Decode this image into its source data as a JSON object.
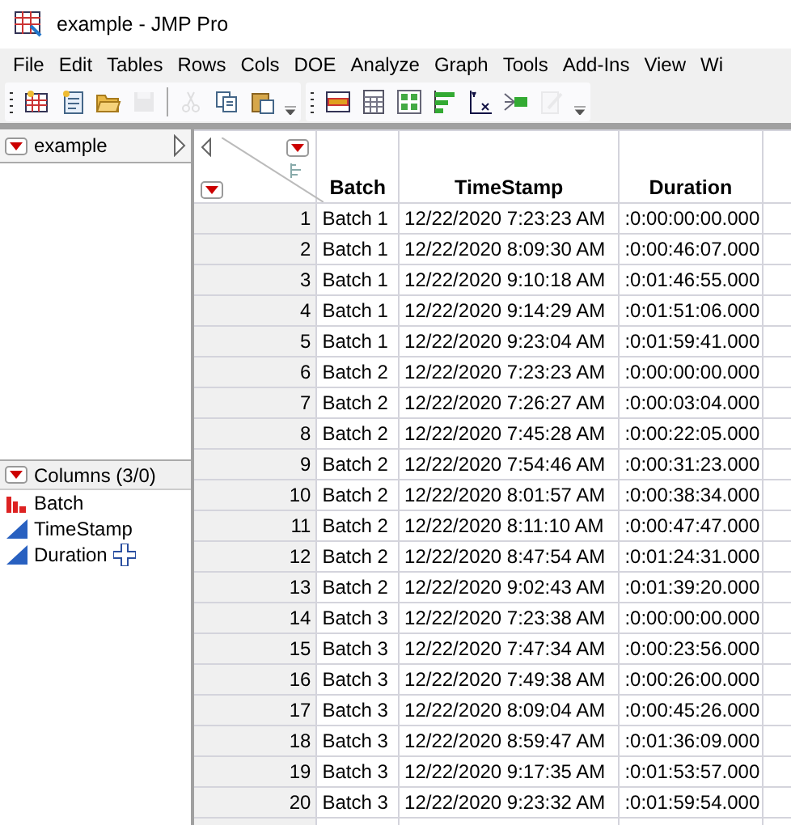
{
  "window": {
    "title": "example - JMP Pro"
  },
  "menu": [
    "File",
    "Edit",
    "Tables",
    "Rows",
    "Cols",
    "DOE",
    "Analyze",
    "Graph",
    "Tools",
    "Add-Ins",
    "View",
    "Wi"
  ],
  "toolbar_groups": [
    [
      {
        "kind": "new-table",
        "disabled": false
      },
      {
        "kind": "new-script",
        "disabled": false
      },
      {
        "kind": "open",
        "disabled": false
      },
      {
        "kind": "save",
        "disabled": true
      },
      {
        "kind": "sep"
      },
      {
        "kind": "cut",
        "disabled": true
      },
      {
        "kind": "copy",
        "disabled": false
      },
      {
        "kind": "paste",
        "disabled": false
      }
    ],
    [
      {
        "kind": "data-table",
        "disabled": false
      },
      {
        "kind": "tabulate",
        "disabled": false
      },
      {
        "kind": "grid",
        "disabled": false
      },
      {
        "kind": "bars",
        "disabled": false
      },
      {
        "kind": "yx",
        "disabled": false
      },
      {
        "kind": "connect",
        "disabled": false
      },
      {
        "kind": "edit",
        "disabled": true
      }
    ]
  ],
  "table_panel": {
    "name": "example"
  },
  "columns_panel": {
    "title": "Columns (3/0)",
    "items": [
      {
        "name": "Batch",
        "kind": "nominal",
        "cursor": false
      },
      {
        "name": "TimeStamp",
        "kind": "continuous",
        "cursor": false
      },
      {
        "name": "Duration",
        "kind": "continuous",
        "cursor": true
      }
    ]
  },
  "table": {
    "columns": [
      "",
      "Batch",
      "TimeStamp",
      "Duration"
    ],
    "rows": [
      [
        "1",
        "Batch 1",
        "12/22/2020 7:23:23 AM",
        ":0:00:00:00.000"
      ],
      [
        "2",
        "Batch 1",
        "12/22/2020 8:09:30 AM",
        ":0:00:46:07.000"
      ],
      [
        "3",
        "Batch 1",
        "12/22/2020 9:10:18 AM",
        ":0:01:46:55.000"
      ],
      [
        "4",
        "Batch 1",
        "12/22/2020 9:14:29 AM",
        ":0:01:51:06.000"
      ],
      [
        "5",
        "Batch 1",
        "12/22/2020 9:23:04 AM",
        ":0:01:59:41.000"
      ],
      [
        "6",
        "Batch 2",
        "12/22/2020 7:23:23 AM",
        ":0:00:00:00.000"
      ],
      [
        "7",
        "Batch 2",
        "12/22/2020 7:26:27 AM",
        ":0:00:03:04.000"
      ],
      [
        "8",
        "Batch 2",
        "12/22/2020 7:45:28 AM",
        ":0:00:22:05.000"
      ],
      [
        "9",
        "Batch 2",
        "12/22/2020 7:54:46 AM",
        ":0:00:31:23.000"
      ],
      [
        "10",
        "Batch 2",
        "12/22/2020 8:01:57 AM",
        ":0:00:38:34.000"
      ],
      [
        "11",
        "Batch 2",
        "12/22/2020 8:11:10 AM",
        ":0:00:47:47.000"
      ],
      [
        "12",
        "Batch 2",
        "12/22/2020 8:47:54 AM",
        ":0:01:24:31.000"
      ],
      [
        "13",
        "Batch 2",
        "12/22/2020 9:02:43 AM",
        ":0:01:39:20.000"
      ],
      [
        "14",
        "Batch 3",
        "12/22/2020 7:23:38 AM",
        ":0:00:00:00.000"
      ],
      [
        "15",
        "Batch 3",
        "12/22/2020 7:47:34 AM",
        ":0:00:23:56.000"
      ],
      [
        "16",
        "Batch 3",
        "12/22/2020 7:49:38 AM",
        ":0:00:26:00.000"
      ],
      [
        "17",
        "Batch 3",
        "12/22/2020 8:09:04 AM",
        ":0:00:45:26.000"
      ],
      [
        "18",
        "Batch 3",
        "12/22/2020 8:59:47 AM",
        ":0:01:36:09.000"
      ],
      [
        "19",
        "Batch 3",
        "12/22/2020 9:17:35 AM",
        ":0:01:53:57.000"
      ],
      [
        "20",
        "Batch 3",
        "12/22/2020 9:23:32 AM",
        ":0:01:59:54.000"
      ]
    ]
  }
}
